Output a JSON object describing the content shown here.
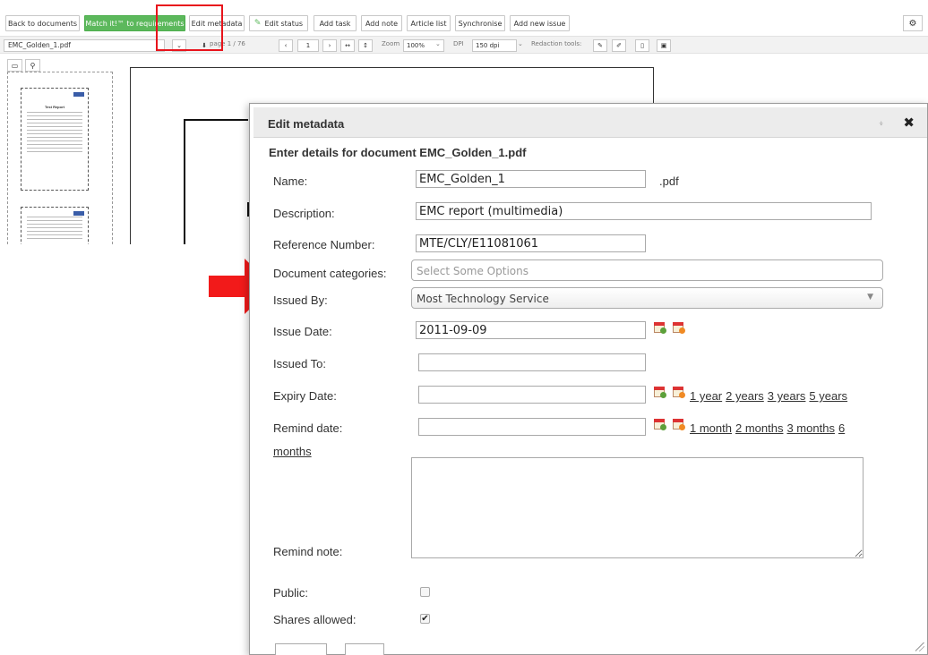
{
  "toolbar": {
    "buttons": [
      "Back to documents",
      "Match it!™ to requirements",
      "Edit metadata",
      "Edit status",
      "Add task",
      "Add note",
      "Article list",
      "Synchronise",
      "Add new issue"
    ],
    "settings_icon": "gear-icon"
  },
  "viewer": {
    "document_select": "EMC_Golden_1.pdf",
    "page_label": "page 1 / 76",
    "page_number": "1",
    "zoom_label": "Zoom",
    "zoom_value": "100%",
    "dpi_label": "DPI",
    "dpi_value": "150 dpi",
    "redaction_label": "Redaction tools:"
  },
  "thumbnails": {
    "first_title": "Test Report"
  },
  "modal": {
    "title": "Edit metadata",
    "subtitle": "Enter details for document EMC_Golden_1.pdf",
    "fields": {
      "name_label": "Name:",
      "name_value": "EMC_Golden_1",
      "name_suffix": ".pdf",
      "description_label": "Description:",
      "description_value": "EMC report (multimedia)",
      "reference_label": "Reference Number:",
      "reference_value": "MTE/CLY/E11081061",
      "categories_label": "Document categories:",
      "categories_placeholder": "Select Some Options",
      "issued_by_label": "Issued By:",
      "issued_by_value": "Most Technology Service",
      "issue_date_label": "Issue Date:",
      "issue_date_value": "2011-09-09",
      "issued_to_label": "Issued To:",
      "issued_to_value": "",
      "expiry_label": "Expiry Date:",
      "expiry_value": "",
      "expiry_links": [
        "1 year",
        "2 years",
        "3 years",
        "5 years"
      ],
      "remind_label": "Remind date:",
      "remind_value": "",
      "remind_links": [
        "1 month",
        "2 months",
        "3 months",
        "6"
      ],
      "remind_links_wrap": "months",
      "remind_note_label": "Remind note:",
      "public_label": "Public:",
      "public_checked": false,
      "shares_label": "Shares allowed:",
      "shares_checked": true
    }
  },
  "colors": {
    "accent_green": "#5cb85c",
    "highlight_red": "#e8141c"
  }
}
